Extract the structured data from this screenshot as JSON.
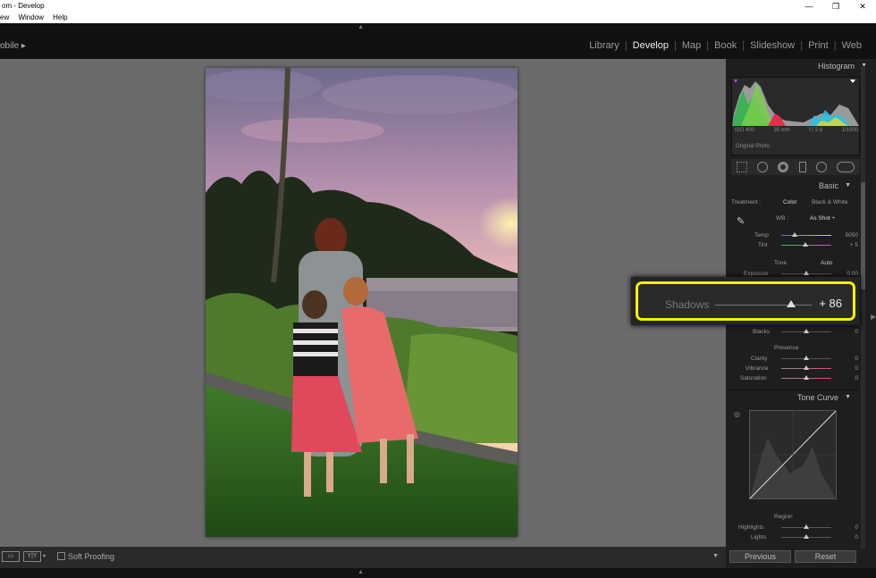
{
  "window": {
    "title": "om - Develop",
    "menu": [
      "ew",
      "Window",
      "Help"
    ],
    "controls": [
      "—",
      "❐",
      "✕"
    ]
  },
  "topbar": {
    "left_label": "obile ▸",
    "modules": [
      {
        "label": "Library",
        "active": false
      },
      {
        "label": "Develop",
        "active": true
      },
      {
        "label": "Map",
        "active": false
      },
      {
        "label": "Book",
        "active": false
      },
      {
        "label": "Slideshow",
        "active": false
      },
      {
        "label": "Print",
        "active": false
      },
      {
        "label": "Web",
        "active": false
      }
    ]
  },
  "histogram": {
    "title": "Histogram",
    "iso": "ISO 400",
    "focal": "35 mm",
    "aperture": "f / 2.8",
    "shutter": "1/1000",
    "original": "Original Photo"
  },
  "basic": {
    "title": "Basic",
    "treatment_label": "Treatment :",
    "color": "Color",
    "bw": "Black & White",
    "wb_label": "WB :",
    "wb_value": "As Shot ÷",
    "temp_label": "Temp",
    "temp_value": "5050",
    "tint_label": "Tint",
    "tint_value": "+ 5",
    "tone_label": "Tone",
    "auto_label": "Auto",
    "exposure_label": "Exposure",
    "exposure_value": "0.00",
    "blacks_label": "Blacks",
    "blacks_value": "0",
    "presence_label": "Presence",
    "clarity_label": "Clarity",
    "clarity_value": "0",
    "vibrance_label": "Vibrance",
    "vibrance_value": "0",
    "saturation_label": "Saturation",
    "saturation_value": "0"
  },
  "zoom_callout": {
    "label": "Shadows",
    "value": "+ 86",
    "highlight_color": "#f2f200"
  },
  "tone_curve": {
    "title": "Tone Curve",
    "region_label": "Region",
    "highlights_label": "Highlights",
    "highlights_value": "0",
    "lights_label": "Lights",
    "lights_value": "0"
  },
  "bottom": {
    "soft_proofing": "Soft Proofing",
    "view_a": "▭",
    "view_b": "Y|Y"
  },
  "actions": {
    "previous": "Previous",
    "reset": "Reset"
  }
}
